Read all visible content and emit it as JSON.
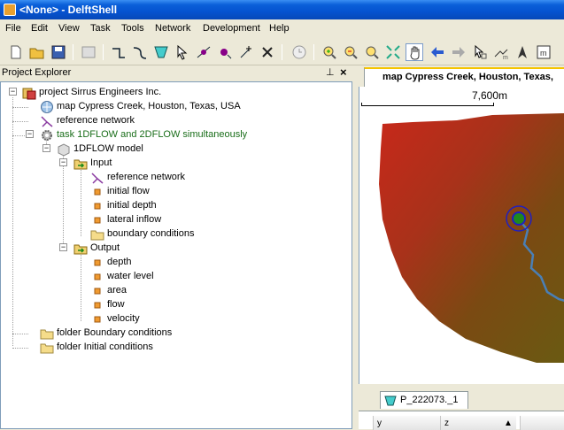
{
  "window": {
    "title": "<None> - DelftShell"
  },
  "menu": [
    "File",
    "Edit",
    "View",
    "Task",
    "Tools",
    "Network",
    "Development",
    "Help"
  ],
  "toolbar": {
    "icons": [
      "new-document-icon",
      "open-folder-icon",
      "save-icon",
      "properties-icon",
      "add-branch-icon",
      "add-curved-branch-icon",
      "add-cross-section-icon",
      "select-arrow-icon",
      "split-branch-icon",
      "add-node-icon",
      "add-point-icon",
      "delete-icon",
      "clock-icon",
      "zoom-in-icon",
      "zoom-out-icon",
      "zoom-extent-icon",
      "full-extent-icon",
      "pan-hand-icon",
      "back-arrow-icon",
      "forward-arrow-icon",
      "select-tool-icon",
      "measure-icon",
      "north-arrow-icon",
      "map-grid-icon"
    ]
  },
  "project_explorer": {
    "title": "Project Explorer",
    "pin": "♫",
    "close": "×",
    "tree": [
      {
        "label": "project Sirrus Engineers Inc.",
        "icon": "project-icon",
        "style": "normal"
      },
      {
        "label": "map Cypress Creek, Houston, Texas, USA",
        "icon": "globe-icon",
        "style": "normal"
      },
      {
        "label": "reference network",
        "icon": "network-icon",
        "style": "normal"
      },
      {
        "label": "task 1DFLOW and 2DFLOW simultaneously",
        "icon": "gear-icon",
        "style": "green"
      },
      {
        "label": "1DFLOW model",
        "icon": "model-icon",
        "style": "normal"
      },
      {
        "label": "Input",
        "icon": "input-folder-icon",
        "style": "normal"
      },
      {
        "label": "reference network",
        "icon": "network-icon",
        "style": "normal"
      },
      {
        "label": "initial flow",
        "icon": "data-item-icon",
        "style": "normal"
      },
      {
        "label": "initial depth",
        "icon": "data-item-icon",
        "style": "normal"
      },
      {
        "label": "lateral inflow",
        "icon": "data-item-icon",
        "style": "normal"
      },
      {
        "label": "boundary conditions",
        "icon": "folder-icon",
        "style": "normal"
      },
      {
        "label": "Output",
        "icon": "output-folder-icon",
        "style": "normal"
      },
      {
        "label": "depth",
        "icon": "data-item-icon",
        "style": "normal"
      },
      {
        "label": "water level",
        "icon": "data-item-icon",
        "style": "normal"
      },
      {
        "label": "area",
        "icon": "data-item-icon",
        "style": "normal"
      },
      {
        "label": "flow",
        "icon": "data-item-icon",
        "style": "normal"
      },
      {
        "label": "velocity",
        "icon": "data-item-icon",
        "style": "normal"
      },
      {
        "label": "folder Boundary conditions",
        "icon": "folder-icon",
        "style": "normal"
      },
      {
        "label": "folder Initial conditions",
        "icon": "folder-icon",
        "style": "normal"
      }
    ]
  },
  "map_view": {
    "tab_label": "map Cypress Creek, Houston, Texas,",
    "scale_label": "7,600m"
  },
  "lower_panel": {
    "tab_label": "P_222073._1",
    "columns": [
      "y",
      "z"
    ]
  },
  "colors": {
    "terrain_high": "#c0281a",
    "terrain_low": "#6b5a10",
    "river": "#4a7fb5",
    "node_fill": "#1e8a1e",
    "node_ring": "#2020c0"
  }
}
